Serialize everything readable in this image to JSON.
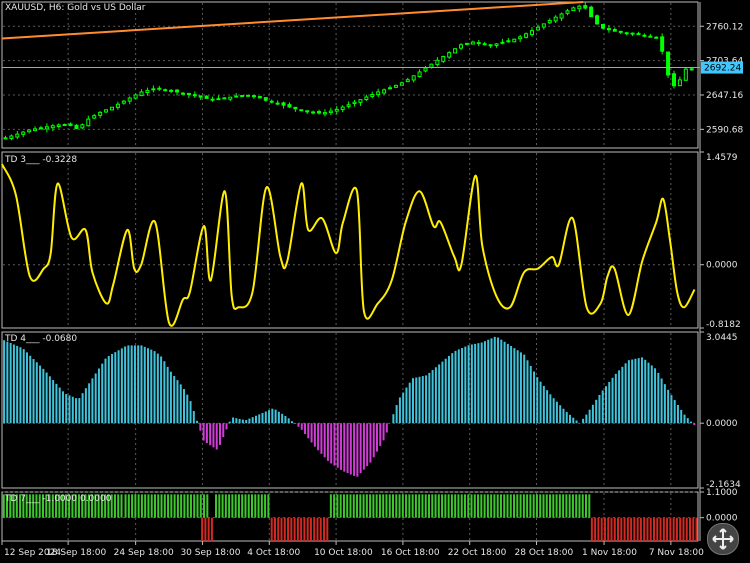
{
  "chart_data": [
    {
      "type": "candlestick",
      "title": "XAUUSD, H6:  Gold vs US Dollar",
      "ylim": [
        2560,
        2800
      ],
      "y_ticks": [
        "2760.12",
        "2703.64",
        "2647.16",
        "2590.68"
      ],
      "current_price": "2692.24",
      "price_line_value": 2692.24,
      "trendline": [
        {
          "x": 0,
          "y": 2740
        },
        {
          "x": 83.5,
          "y": 2800
        }
      ],
      "close_series": [
        [
          0,
          2575
        ],
        [
          2,
          2582
        ],
        [
          4,
          2590
        ],
        [
          6,
          2594
        ],
        [
          8,
          2598
        ],
        [
          10,
          2597
        ],
        [
          11,
          2590
        ],
        [
          12,
          2605
        ],
        [
          14,
          2618
        ],
        [
          16,
          2628
        ],
        [
          18,
          2640
        ],
        [
          20,
          2652
        ],
        [
          22,
          2658
        ],
        [
          24,
          2655
        ],
        [
          26,
          2650
        ],
        [
          28,
          2645
        ],
        [
          30,
          2640
        ],
        [
          32,
          2642
        ],
        [
          34,
          2646
        ],
        [
          36,
          2647
        ],
        [
          38,
          2638
        ],
        [
          40,
          2632
        ],
        [
          42,
          2625
        ],
        [
          44,
          2619
        ],
        [
          46,
          2617
        ],
        [
          48,
          2623
        ],
        [
          50,
          2632
        ],
        [
          52,
          2642
        ],
        [
          54,
          2652
        ],
        [
          56,
          2660
        ],
        [
          58,
          2670
        ],
        [
          60,
          2685
        ],
        [
          62,
          2700
        ],
        [
          64,
          2715
        ],
        [
          66,
          2730
        ],
        [
          68,
          2735
        ],
        [
          70,
          2728
        ],
        [
          72,
          2734
        ],
        [
          74,
          2740
        ],
        [
          76,
          2752
        ],
        [
          78,
          2765
        ],
        [
          80,
          2778
        ],
        [
          82,
          2790
        ],
        [
          83.5,
          2795
        ],
        [
          85,
          2770
        ],
        [
          86,
          2758
        ],
        [
          88,
          2752
        ],
        [
          90,
          2748
        ],
        [
          92,
          2746
        ],
        [
          94,
          2742
        ],
        [
          95,
          2715
        ],
        [
          96,
          2665
        ],
        [
          97,
          2660
        ],
        [
          98,
          2690
        ],
        [
          99.5,
          2688
        ]
      ],
      "up_color": "#00ff00",
      "trend_color": "#ff8c2e",
      "price_line_color": "#3ec8ff"
    },
    {
      "type": "line",
      "title": "TD 3___  -0.3228",
      "ylim": [
        -0.8182,
        1.4579
      ],
      "y_ticks": [
        "1.4579",
        "0.0000",
        "-0.8182"
      ],
      "color": "#ffee00",
      "x": [
        0,
        2,
        4,
        6,
        7,
        8,
        10,
        12,
        13,
        15,
        16,
        18,
        19,
        20,
        22,
        24,
        26,
        27,
        29,
        30,
        32,
        33,
        34,
        36,
        38,
        40,
        41,
        43,
        44,
        46,
        48,
        49,
        51,
        52,
        54,
        56,
        58,
        60,
        62,
        63,
        65,
        66,
        68,
        69,
        71,
        73,
        75,
        77,
        79,
        80,
        82,
        84,
        86,
        87,
        88,
        90,
        92,
        94,
        95,
        96,
        97,
        98,
        99.5
      ],
      "y": [
        1.3,
        0.9,
        -0.15,
        -0.05,
        0.15,
        1.05,
        0.35,
        0.45,
        -0.1,
        -0.5,
        -0.25,
        0.45,
        -0.05,
        0.0,
        0.55,
        -0.75,
        -0.45,
        -0.35,
        0.5,
        -0.2,
        0.95,
        -0.4,
        -0.55,
        -0.35,
        1.0,
        0.1,
        0.05,
        1.05,
        0.45,
        0.6,
        0.15,
        0.55,
        0.95,
        -0.6,
        -0.5,
        -0.2,
        0.55,
        0.95,
        0.5,
        0.55,
        0.1,
        0.0,
        1.15,
        0.25,
        -0.4,
        -0.55,
        -0.1,
        -0.05,
        0.1,
        0.0,
        0.6,
        -0.55,
        -0.5,
        -0.15,
        -0.05,
        -0.65,
        0.05,
        0.55,
        0.85,
        0.3,
        -0.35,
        -0.55,
        -0.32
      ]
    },
    {
      "type": "bar",
      "title": "TD 4___  -0.0680",
      "ylim": [
        -2.1634,
        3.0445
      ],
      "y_ticks": [
        "3.0445",
        "0.0000",
        "-2.1634"
      ],
      "pos_color": "#3fc4dc",
      "neg_color": "#d23cd8",
      "x": [
        0,
        3,
        6,
        9,
        11,
        13,
        15,
        18,
        20,
        22,
        23,
        24,
        26,
        27,
        29,
        31,
        33,
        35,
        37,
        39,
        41,
        43,
        45,
        47,
        49,
        51,
        53,
        55,
        57,
        59,
        61,
        63,
        65,
        67,
        69,
        71,
        73,
        75,
        77,
        79,
        81,
        83,
        84,
        86,
        88,
        90,
        92,
        94,
        96,
        98,
        99.5
      ],
      "y": [
        2.8,
        2.5,
        1.8,
        1.0,
        0.8,
        1.5,
        2.2,
        2.6,
        2.6,
        2.4,
        2.2,
        1.8,
        1.2,
        0.8,
        -0.6,
        -0.9,
        0.2,
        0.1,
        0.3,
        0.5,
        0.2,
        -0.2,
        -0.8,
        -1.3,
        -1.6,
        -1.8,
        -1.3,
        -0.5,
        0.8,
        1.5,
        1.6,
        2.0,
        2.4,
        2.6,
        2.7,
        2.9,
        2.6,
        2.3,
        1.5,
        0.9,
        0.4,
        0.0,
        0.3,
        1.0,
        1.6,
        2.1,
        2.2,
        1.8,
        1.0,
        0.3,
        -0.07
      ]
    },
    {
      "type": "bar",
      "title": "TD 7___  -1.0000 0.0000",
      "ylim": [
        -1.0,
        1.1
      ],
      "y_ticks": [
        "1.1000",
        "0.0000"
      ],
      "pos_color": "#3ec82e",
      "neg_color": "#d02a22",
      "segments": [
        {
          "from": 0,
          "to": 17.5,
          "value": 1
        },
        {
          "from": 17.5,
          "to": 29.5,
          "value": 1
        },
        {
          "from": 28.5,
          "to": 30.5,
          "value": -1
        },
        {
          "from": 30.5,
          "to": 38.5,
          "value": 1
        },
        {
          "from": 38.5,
          "to": 47,
          "value": -1
        },
        {
          "from": 47,
          "to": 84.5,
          "value": 1
        },
        {
          "from": 84.5,
          "to": 100,
          "value": -1
        }
      ]
    }
  ],
  "x_axis": {
    "labels": [
      {
        "text": "12 Sep 2024",
        "x": 0
      },
      {
        "text": "18 Sep 18:00",
        "x": 9.5
      },
      {
        "text": "24 Sep 18:00",
        "x": 19.2
      },
      {
        "text": "30 Sep 18:00",
        "x": 28.8
      },
      {
        "text": "4 Oct 18:00",
        "x": 38.4
      },
      {
        "text": "10 Oct 18:00",
        "x": 48.0
      },
      {
        "text": "16 Oct 18:00",
        "x": 57.6
      },
      {
        "text": "22 Oct 18:00",
        "x": 67.2
      },
      {
        "text": "28 Oct 18:00",
        "x": 76.8
      },
      {
        "text": "1 Nov 18:00",
        "x": 86.5
      },
      {
        "text": "7 Nov 18:00",
        "x": 96.1
      }
    ]
  }
}
